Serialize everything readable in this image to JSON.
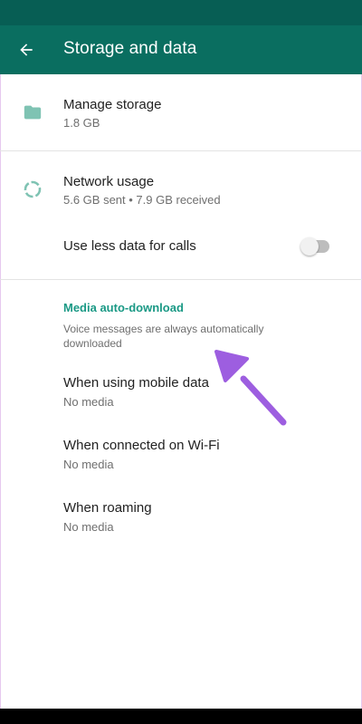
{
  "colors": {
    "status_bar": "#075e54",
    "app_bar": "#0a6e60",
    "accent": "#1a9985",
    "icon_teal": "#7fc3b3",
    "arrow": "#9d5ee0"
  },
  "header": {
    "title": "Storage and data",
    "back_icon": "arrow-back-icon"
  },
  "storage": {
    "manage": {
      "title": "Manage storage",
      "subtitle": "1.8 GB",
      "icon": "folder-icon"
    },
    "network": {
      "title": "Network usage",
      "subtitle": "5.6 GB sent • 7.9 GB received",
      "icon": "data-usage-icon"
    },
    "less_data": {
      "title": "Use less data for calls",
      "toggle_on": false
    }
  },
  "media": {
    "header": "Media auto-download",
    "note": "Voice messages are always automatically downloaded",
    "items": [
      {
        "title": "When using mobile data",
        "subtitle": "No media"
      },
      {
        "title": "When connected on Wi-Fi",
        "subtitle": "No media"
      },
      {
        "title": "When roaming",
        "subtitle": "No media"
      }
    ]
  }
}
